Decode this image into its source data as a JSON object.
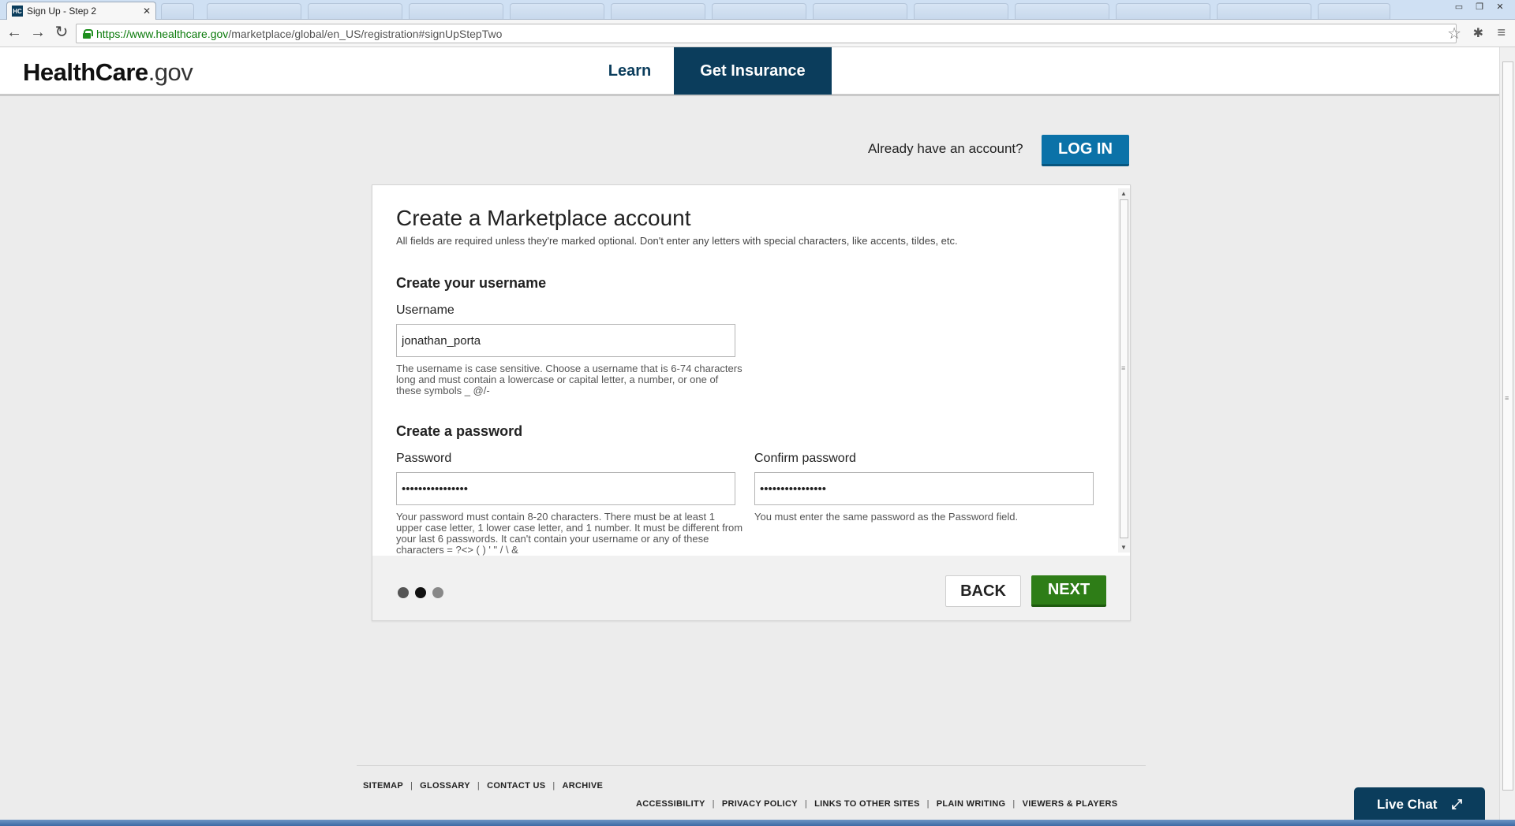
{
  "browser": {
    "tab_title": "Sign Up - Step 2",
    "tab_favicon_text": "HC",
    "url_host": "https://www.healthcare.gov",
    "url_path": "/marketplace/global/en_US/registration#signUpStepTwo"
  },
  "site": {
    "logo_main": "HealthCare",
    "logo_suffix": ".gov",
    "nav": {
      "learn": "Learn",
      "get_insurance": "Get Insurance"
    }
  },
  "account": {
    "already_text": "Already have an account?",
    "login_label": "LOG IN"
  },
  "form": {
    "title": "Create a Marketplace account",
    "subtitle": "All fields are required unless they're marked optional. Don't enter any letters with special characters, like accents, tildes, etc.",
    "username_section": "Create your username",
    "username_label": "Username",
    "username_value": "jonathan_porta",
    "username_hint": "The username is case sensitive. Choose a username that is 6-74 characters long and must contain a lowercase or capital letter, a number, or one of these symbols _ @/-",
    "password_section": "Create a password",
    "password_label": "Password",
    "password_value": "••••••••••••••••",
    "password_hint": "Your password must contain 8-20 characters. There must be at least 1 upper case letter, 1 lower case letter, and 1 number. It must be different from your last 6 passwords. It can't contain your username or any of these characters = ?<> ( ) ' \" / \\ &",
    "confirm_label": "Confirm password",
    "confirm_value": "••••••••••••••••",
    "confirm_hint": "You must enter the same password as the Password field.",
    "back_label": "BACK",
    "next_label": "NEXT",
    "steps_total": 3,
    "current_step": 2
  },
  "footer": {
    "row1": [
      "SITEMAP",
      "GLOSSARY",
      "CONTACT US",
      "ARCHIVE"
    ],
    "row2": [
      "ACCESSIBILITY",
      "PRIVACY POLICY",
      "LINKS TO OTHER SITES",
      "PLAIN WRITING",
      "VIEWERS & PLAYERS"
    ]
  },
  "live_chat_label": "Live Chat",
  "colors": {
    "brand_navy": "#0b3d5c",
    "login_blue": "#0b72a8",
    "next_green": "#2e7d17"
  }
}
